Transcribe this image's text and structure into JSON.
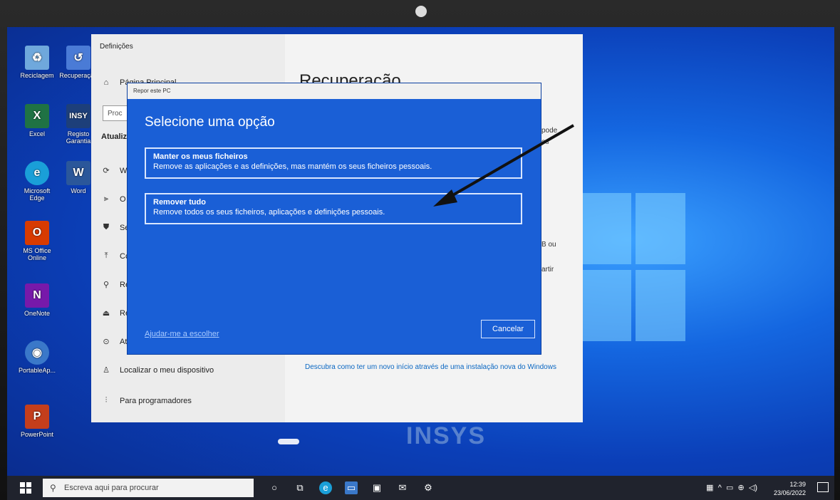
{
  "settings": {
    "window_title": "Definições",
    "home_label": "Página Principal",
    "search_placeholder": "Proc",
    "section_label": "Atualiz",
    "page_heading": "Recuperação",
    "nav_items": [
      {
        "icon": "sync-icon",
        "label": "W"
      },
      {
        "icon": "delivery-icon",
        "label": "O"
      },
      {
        "icon": "shield-icon",
        "label": "Se"
      },
      {
        "icon": "backup-icon",
        "label": "Cc"
      },
      {
        "icon": "wrench-icon",
        "label": "Re"
      },
      {
        "icon": "recovery-icon",
        "label": "Re"
      },
      {
        "icon": "activation-icon",
        "label": "At"
      },
      {
        "icon": "find-device-icon",
        "label": "Localizar o meu dispositivo"
      },
      {
        "icon": "developer-icon",
        "label": "Para programadores"
      }
    ],
    "right_fragments": [
      "pode",
      "os",
      "B ou",
      "artir"
    ],
    "fresh_start_link": "Descubra como ter um novo início através de uma instalação nova do Windows"
  },
  "dialog": {
    "window_title": "Repor este PC",
    "title": "Selecione uma opção",
    "options": [
      {
        "title": "Manter os meus ficheiros",
        "description": "Remove as aplicações e as definições, mas mantém os seus ficheiros pessoais."
      },
      {
        "title": "Remover tudo",
        "description": "Remove todos os seus ficheiros, aplicações e definições pessoais."
      }
    ],
    "help_link": "Ajudar-me a escolher",
    "cancel_label": "Cancelar"
  },
  "desktop_icons": [
    {
      "label": "Reciclagem",
      "icon": "recycle-bin-icon",
      "color": "#6fa8dc"
    },
    {
      "label": "Recuperação",
      "icon": "recovery-app-icon",
      "color": "#4a7bd6"
    },
    {
      "label": "Excel",
      "icon": "excel-icon",
      "color": "#1f7244",
      "glyph": "X"
    },
    {
      "label": "Registo Garantia",
      "icon": "insys-icon",
      "color": "#1d3f7a",
      "glyph": "INSY"
    },
    {
      "label": "Microsoft Edge",
      "icon": "edge-icon",
      "color": "#1a9fd8",
      "glyph": "e"
    },
    {
      "label": "Word",
      "icon": "word-icon",
      "color": "#2b579a",
      "glyph": "W"
    },
    {
      "label": "MS Office Online",
      "icon": "office-icon",
      "color": "#d83b01",
      "glyph": "O"
    },
    {
      "label": "OneNote",
      "icon": "onenote-icon",
      "color": "#7719aa",
      "glyph": "N"
    },
    {
      "label": "PortableAp...",
      "icon": "portableapps-icon",
      "color": "#3a78c9",
      "glyph": "◉"
    },
    {
      "label": "PowerPoint",
      "icon": "powerpoint-icon",
      "color": "#c43e1c",
      "glyph": "P"
    }
  ],
  "brand": "INSYS",
  "taskbar": {
    "search_placeholder": "Escreva aqui para procurar",
    "time": "12:39",
    "date": "23/06/2022"
  },
  "colors": {
    "dialog_bg": "#1a5fd6",
    "taskbar_bg": "#20232d",
    "desktop_blue": "#1466e0"
  }
}
